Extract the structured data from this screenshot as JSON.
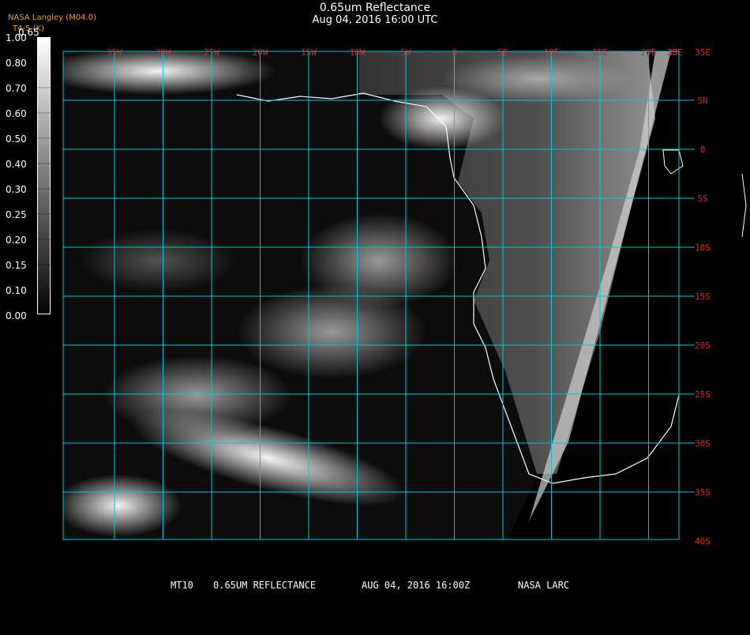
{
  "header": {
    "title": "0.65um Reflectance",
    "subtitle": "Aug 04, 2016 16:00 UTC",
    "credit_org": "NASA Langley (M04.0)",
    "credit_channel": "T4-5 (K)",
    "colorbar_top_label": "0.65"
  },
  "colorbar": {
    "ticks": [
      "1.00",
      "0.80",
      "0.70",
      "0.60",
      "0.50",
      "0.40",
      "0.30",
      "0.25",
      "0.20",
      "0.15",
      "0.10",
      "0.00"
    ]
  },
  "map": {
    "lon_labels": [
      "35W",
      "30W",
      "25W",
      "20W",
      "15W",
      "10W",
      "5W",
      "0",
      "5E",
      "10E",
      "15E",
      "20E",
      "25E",
      "30E",
      "35E"
    ],
    "lat_labels": [
      "5N",
      "0",
      "5S",
      "10S",
      "15S",
      "20S",
      "25S",
      "30S",
      "35S",
      "40S"
    ],
    "grid_color": "#00c8d8",
    "label_color": "#dd2222",
    "coastline_color": "#ffffff"
  },
  "footer": {
    "satellite": "MT10",
    "product": "0.65UM REFLECTANCE",
    "datetime": "AUG 04, 2016 16:00Z",
    "source": "NASA LARC"
  }
}
